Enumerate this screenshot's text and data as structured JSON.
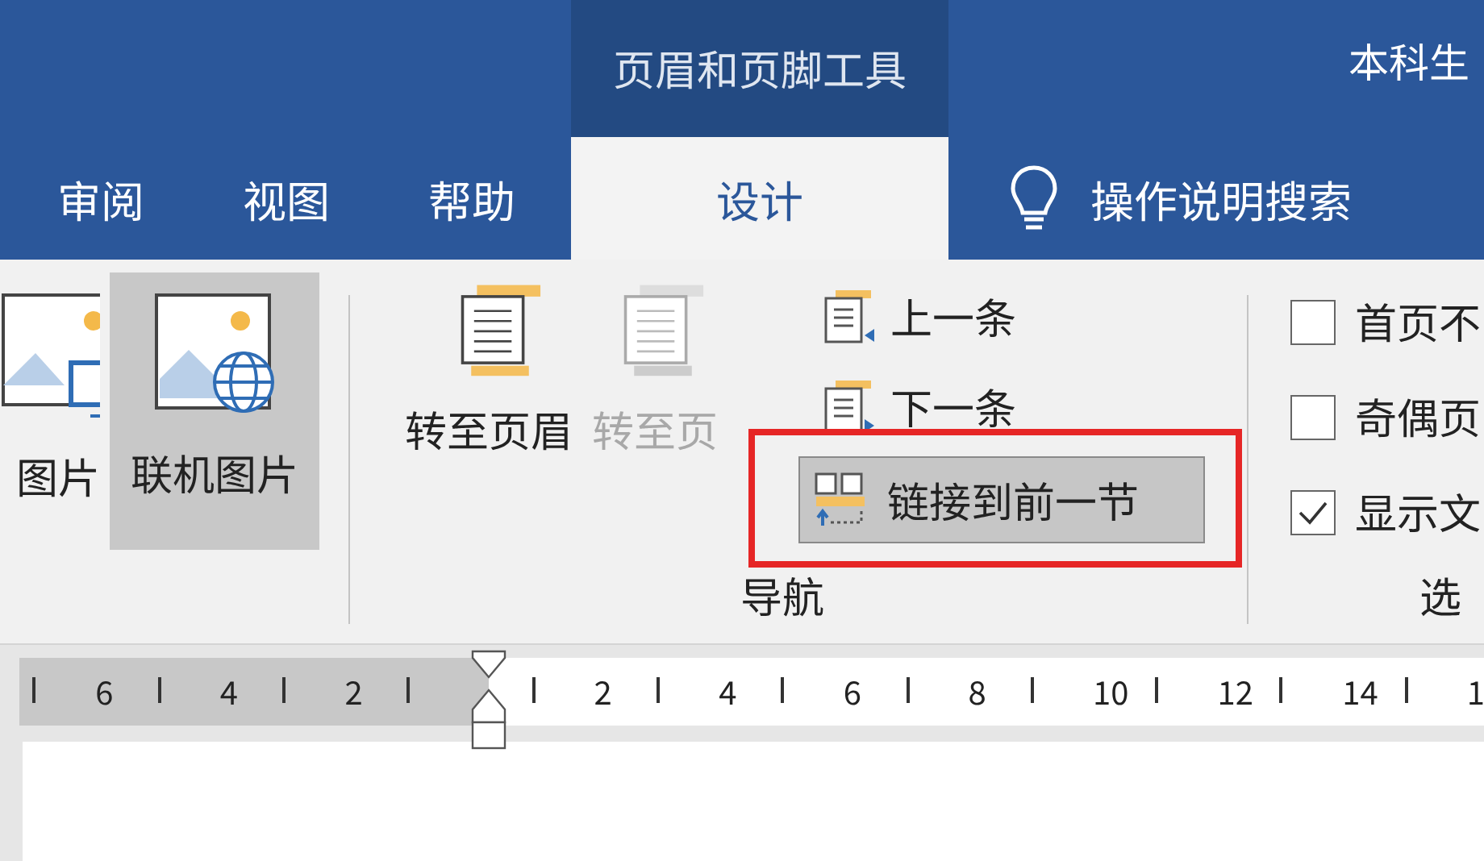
{
  "title_bar": {
    "context_group": "页眉和页脚工具",
    "document_title": "本科生"
  },
  "tabs": [
    {
      "label": "审阅",
      "selected": false
    },
    {
      "label": "视图",
      "selected": false
    },
    {
      "label": "帮助",
      "selected": false
    },
    {
      "label": "设计",
      "selected": true
    }
  ],
  "search": {
    "label": "操作说明搜索"
  },
  "insert_buttons": [
    {
      "label": "图片",
      "kind": "monitor",
      "selected": false
    },
    {
      "label": "联机图片",
      "kind": "globe",
      "selected": true
    }
  ],
  "navigation": {
    "large_buttons": [
      {
        "label": "转至页眉",
        "kind": "header",
        "disabled": false
      },
      {
        "label": "转至页",
        "kind": "footer",
        "disabled": true
      }
    ],
    "small_buttons": [
      {
        "label": "上一条",
        "kind": "previous",
        "pressed": false
      },
      {
        "label": "下一条",
        "kind": "next",
        "pressed": false
      },
      {
        "label": "链接到前一节",
        "kind": "link",
        "pressed": true
      }
    ],
    "group_label": "导航"
  },
  "options": {
    "checkboxes": [
      {
        "label": "首页不",
        "checked": false
      },
      {
        "label": "奇偶页",
        "checked": false
      },
      {
        "label": "显示文",
        "checked": true
      }
    ],
    "group_label": "选"
  },
  "ruler": {
    "left_labels": [
      "6",
      "4",
      "2"
    ],
    "right_labels": [
      "2",
      "4",
      "6",
      "8",
      "10",
      "12",
      "14",
      "1"
    ]
  }
}
